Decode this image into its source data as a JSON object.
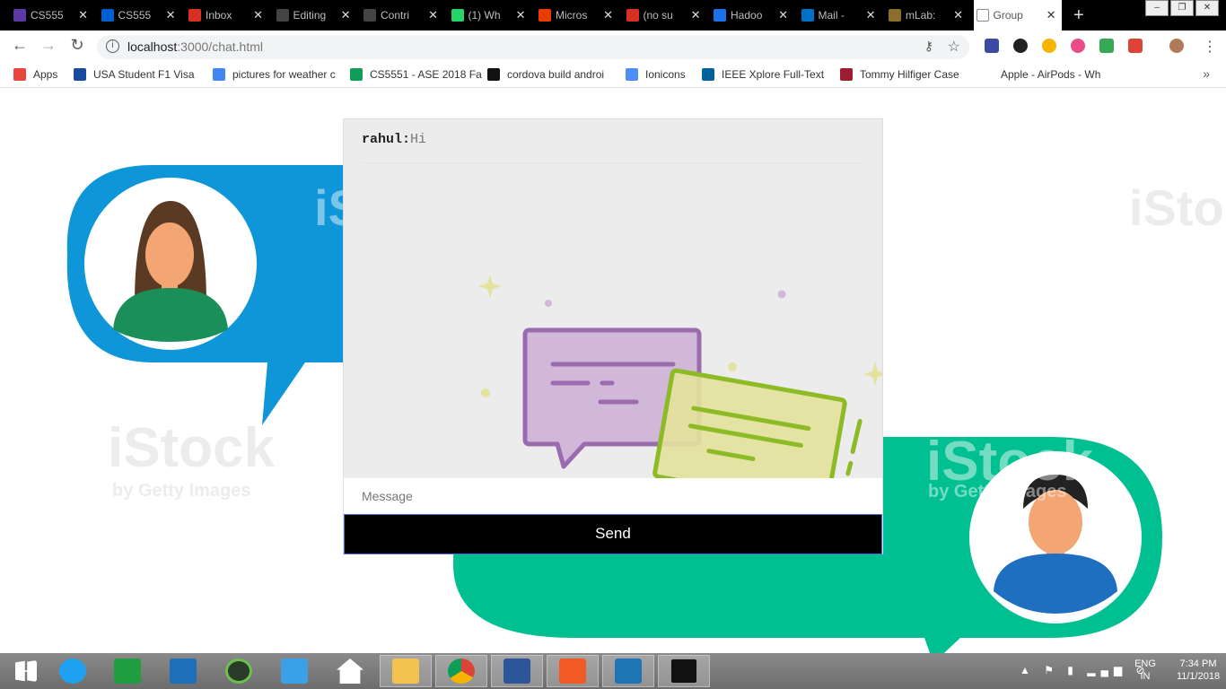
{
  "browser": {
    "tabs": [
      {
        "title": "CS555",
        "color": "#5c3aa6"
      },
      {
        "title": "CS555",
        "color": "#0061d5"
      },
      {
        "title": "Inbox",
        "color": "#d93025"
      },
      {
        "title": "Editing",
        "color": "#444444"
      },
      {
        "title": "Contri",
        "color": "#444444"
      },
      {
        "title": "(1) Wh",
        "color": "#25d366"
      },
      {
        "title": "Micros",
        "color": "#eb3c00"
      },
      {
        "title": "(no su",
        "color": "#d93025"
      },
      {
        "title": "Hadoo",
        "color": "#1a73e8"
      },
      {
        "title": "Mail -",
        "color": "#0072c6"
      },
      {
        "title": "mLab:",
        "color": "#8b6d2c"
      },
      {
        "title": "Group",
        "color": "#ffffff"
      }
    ],
    "url_host": "localhost",
    "url_rest": ":3000/chat.html",
    "bookmarks": [
      {
        "label": "Apps",
        "color": "#e8453c"
      },
      {
        "label": "USA Student F1 Visa",
        "color": "#1a4a9e"
      },
      {
        "label": "pictures for weather c",
        "color": "#4285f4"
      },
      {
        "label": "CS5551 - ASE 2018 Fa",
        "color": "#0f9d58"
      },
      {
        "label": "cordova build androi",
        "color": "#111111"
      },
      {
        "label": "Ionicons",
        "color": "#4e8ef7"
      },
      {
        "label": "IEEE Xplore Full-Text",
        "color": "#00629b"
      },
      {
        "label": "Tommy Hilfiger Case",
        "color": "#9e1b32"
      },
      {
        "label": "Apple - AirPods - Wh",
        "color": "#ffffff"
      }
    ],
    "more": "»"
  },
  "chat": {
    "messages": [
      {
        "user": "rahul",
        "text": "Hi"
      }
    ],
    "input_placeholder": "Message",
    "send_label": "Send"
  },
  "watermark": {
    "brand": "iStock",
    "sub": "by Getty Images"
  },
  "taskbar": {
    "apps": [
      "windows-start",
      "internet-explorer",
      "windows-store",
      "lenovo",
      "media-app",
      "mail-app",
      "home-app",
      "file-explorer",
      "chrome",
      "word",
      "acrobat",
      "brackets",
      "command-prompt"
    ],
    "lang_top": "ENG",
    "lang_bottom": "IN",
    "time": "7:34 PM",
    "date": "11/1/2018"
  },
  "colors": {
    "blue_bubble": "#0f96d8",
    "green_bubble": "#00bf90",
    "purple_card": "#d2b8d8",
    "yellow_card": "#e4e29c"
  }
}
